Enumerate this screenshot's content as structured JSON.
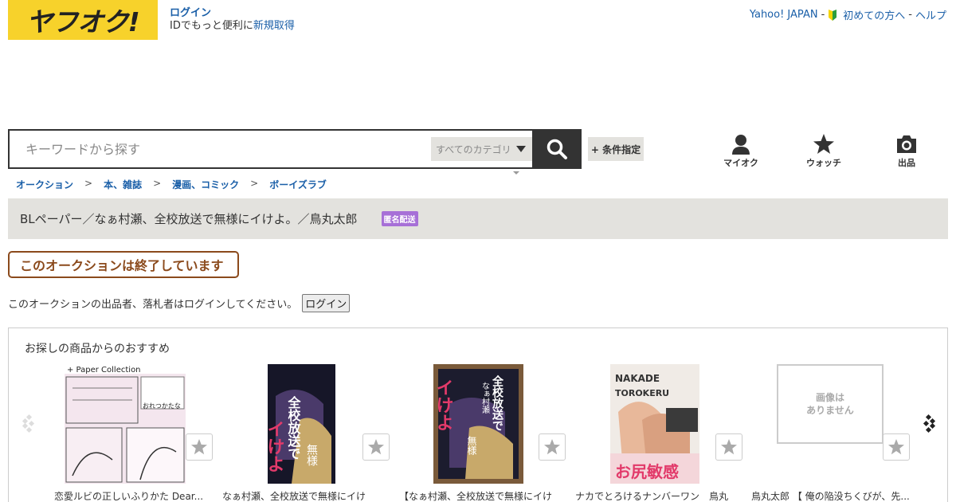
{
  "header": {
    "logo_text": "ヤフオク!",
    "login_link": "ログイン",
    "login_sub_prefix": "IDでもっと便利に",
    "register_link": "新規取得",
    "links": {
      "yahoo_japan": "Yahoo! JAPAN",
      "beginner": "初めての方へ",
      "help": "ヘルプ",
      "separator": "-"
    }
  },
  "search": {
    "placeholder": "キーワードから探す",
    "category_value": "すべてのカテゴリ",
    "search_icon": "search-icon",
    "condition_button": "+ 条件指定"
  },
  "nav": [
    {
      "label": "マイオク",
      "icon": "user-icon"
    },
    {
      "label": "ウォッチ",
      "icon": "star-icon"
    },
    {
      "label": "出品",
      "icon": "camera-icon"
    }
  ],
  "breadcrumb": {
    "items": [
      "オークション",
      "本、雑誌",
      "漫画、コミック",
      "ボーイズラブ"
    ],
    "separator": ">"
  },
  "listing": {
    "title": "BLペーパー／なぁ村瀬、全校放送で無様にイけよ。／鳥丸太郎",
    "badge": "匿名配送",
    "ended_label": "このオークションは終了しています",
    "login_message": "このオークションの出品者、落札者はログインしてください。",
    "login_button": "ログイン"
  },
  "recommend": {
    "title": "お探しの商品からのおすすめ",
    "items": [
      {
        "caption": "恋愛ルビの正しいふりかた Dear...",
        "thumb_texts": [
          "+ Paper Collection",
          "おれつかたな"
        ]
      },
      {
        "caption": "なぁ村瀬、全校放送で無様にイけ",
        "thumb_texts": [
          "全校放送で",
          "イけよ",
          "無様"
        ]
      },
      {
        "caption": "【なぁ村瀬、全校放送で無様にイけ",
        "thumb_texts": [
          "全校放送で",
          "なぁ村瀬",
          "イけよ",
          "無様"
        ]
      },
      {
        "caption": "ナカでとろけるナンバーワン　鳥丸",
        "thumb_texts": [
          "NAKADE",
          "TOROKERU",
          "お尻敏感"
        ]
      },
      {
        "caption": "鳥丸太郎 【 俺の陥没ちくびが、先...",
        "no_image_text": [
          "画像は",
          "ありません"
        ]
      }
    ]
  },
  "colors": {
    "brand_yellow": "#f7d22b",
    "link_blue": "#1a5fa8",
    "ended_brown": "#8b4a1c",
    "badge_purple": "#a770d7",
    "bar_gray": "#e3e2de"
  }
}
